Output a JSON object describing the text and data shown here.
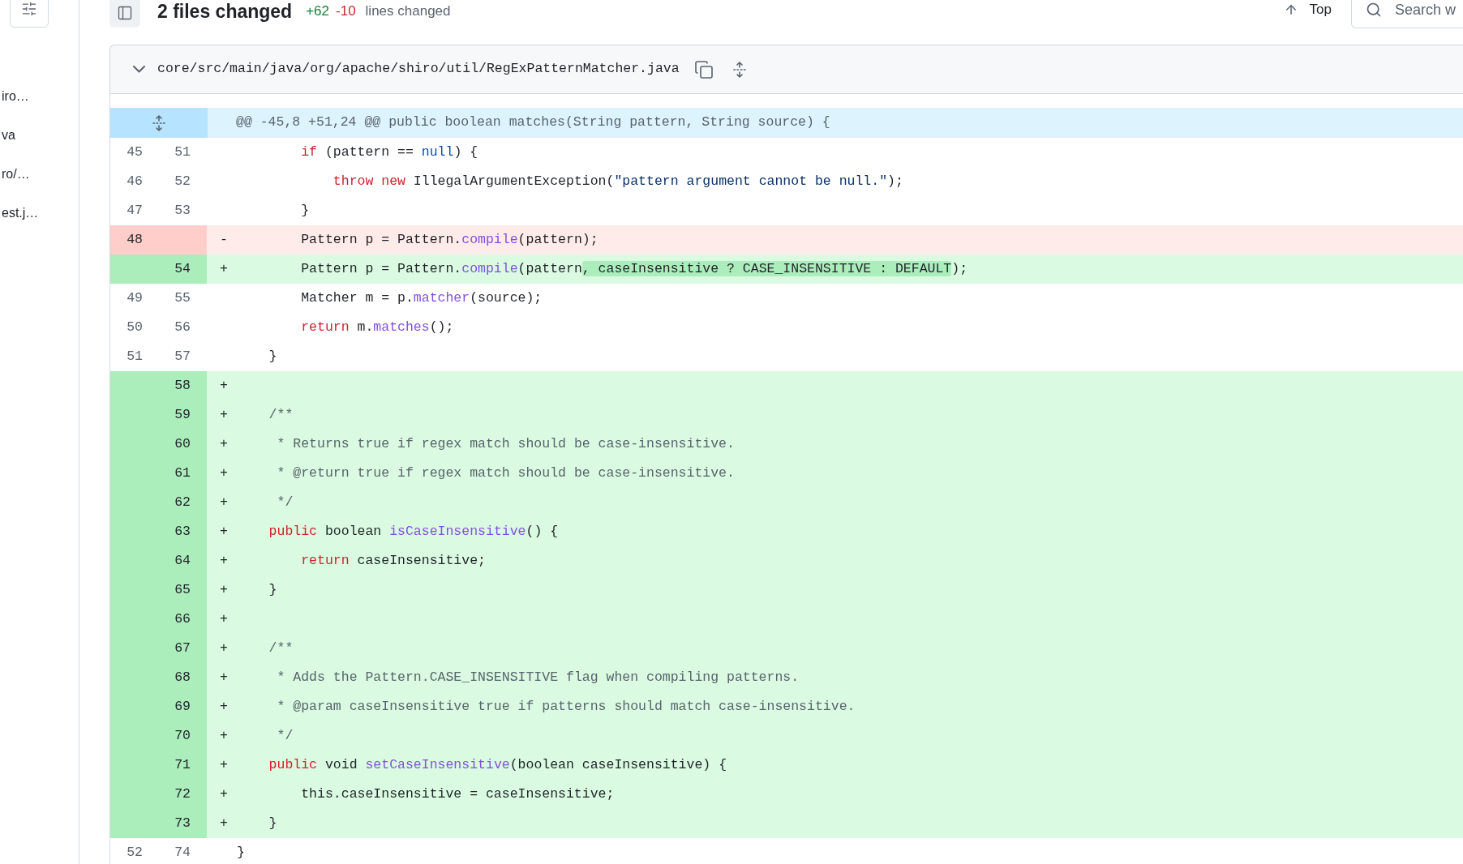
{
  "sidebar": {
    "items": [
      "iro…",
      "va",
      "ro/…",
      "est.j…"
    ]
  },
  "header": {
    "title": "2 files changed",
    "additions": "+62",
    "deletions": "-10",
    "summary": "lines changed",
    "top_link": "Top",
    "search": {
      "placeholder": "Search w"
    }
  },
  "file": {
    "path": "core/src/main/java/org/apache/shiro/util/RegExPatternMatcher.java",
    "expanded": true,
    "rows": [
      {
        "kind": "hunk",
        "text": "@@ -45,8 +51,24 @@ public boolean matches(String pattern, String source) {"
      },
      {
        "kind": "context",
        "old": "45",
        "new": "51",
        "tokens": [
          {
            "kind": "keyword",
            "text": "        if"
          },
          {
            "kind": "text",
            "text": " (pattern == "
          },
          {
            "kind": "literal",
            "text": "null"
          },
          {
            "kind": "text",
            "text": ") {"
          }
        ]
      },
      {
        "kind": "context",
        "old": "46",
        "new": "52",
        "tokens": [
          {
            "kind": "keyword",
            "text": "            throw new"
          },
          {
            "kind": "text",
            "text": " IllegalArgumentException("
          },
          {
            "kind": "string",
            "text": "\"pattern argument cannot be null.\""
          },
          {
            "kind": "text",
            "text": ");"
          }
        ]
      },
      {
        "kind": "context",
        "old": "47",
        "new": "53",
        "tokens": [
          {
            "kind": "text",
            "text": "        }"
          }
        ]
      },
      {
        "kind": "deleted",
        "old": "48",
        "sign": "-",
        "tokens": [
          {
            "kind": "text",
            "text": "        Pattern p = Pattern."
          },
          {
            "kind": "method",
            "text": "compile"
          },
          {
            "kind": "text",
            "text": "(pattern);"
          }
        ]
      },
      {
        "kind": "added",
        "new": "54",
        "sign": "+",
        "tokens": [
          {
            "kind": "text",
            "text": "        Pattern p = Pattern."
          },
          {
            "kind": "method",
            "text": "compile"
          },
          {
            "kind": "text",
            "text": "(pattern"
          },
          {
            "kind": "inserted",
            "text": ", caseInsensitive ? CASE_INSENSITIVE : DEFAULT"
          },
          {
            "kind": "text",
            "text": ");"
          }
        ]
      },
      {
        "kind": "context",
        "old": "49",
        "new": "55",
        "tokens": [
          {
            "kind": "text",
            "text": "        Matcher m = p."
          },
          {
            "kind": "method",
            "text": "matcher"
          },
          {
            "kind": "text",
            "text": "(source);"
          }
        ]
      },
      {
        "kind": "context",
        "old": "50",
        "new": "56",
        "tokens": [
          {
            "kind": "keyword",
            "text": "        return"
          },
          {
            "kind": "text",
            "text": " m."
          },
          {
            "kind": "method",
            "text": "matches"
          },
          {
            "kind": "text",
            "text": "();"
          }
        ]
      },
      {
        "kind": "context",
        "old": "51",
        "new": "57",
        "tokens": [
          {
            "kind": "text",
            "text": "    }"
          }
        ]
      },
      {
        "kind": "added",
        "new": "58",
        "sign": "+"
      },
      {
        "kind": "added",
        "new": "59",
        "sign": "+",
        "tokens": [
          {
            "kind": "comment",
            "text": "    /**"
          }
        ]
      },
      {
        "kind": "added",
        "new": "60",
        "sign": "+",
        "tokens": [
          {
            "kind": "comment",
            "text": "     * Returns true if regex match should be case-insensitive."
          }
        ]
      },
      {
        "kind": "added",
        "new": "61",
        "sign": "+",
        "tokens": [
          {
            "kind": "comment",
            "text": "     * @return true if regex match should be case-insensitive."
          }
        ]
      },
      {
        "kind": "added",
        "new": "62",
        "sign": "+",
        "tokens": [
          {
            "kind": "comment",
            "text": "     */"
          }
        ]
      },
      {
        "kind": "added",
        "new": "63",
        "sign": "+",
        "tokens": [
          {
            "kind": "keyword",
            "text": "    public"
          },
          {
            "kind": "text",
            "text": " boolean "
          },
          {
            "kind": "method",
            "text": "isCaseInsensitive"
          },
          {
            "kind": "text",
            "text": "() {"
          }
        ]
      },
      {
        "kind": "added",
        "new": "64",
        "sign": "+",
        "tokens": [
          {
            "kind": "keyword",
            "text": "        return"
          },
          {
            "kind": "text",
            "text": " caseInsensitive;"
          }
        ]
      },
      {
        "kind": "added",
        "new": "65",
        "sign": "+",
        "tokens": [
          {
            "kind": "text",
            "text": "    }"
          }
        ]
      },
      {
        "kind": "added",
        "new": "66",
        "sign": "+"
      },
      {
        "kind": "added",
        "new": "67",
        "sign": "+",
        "tokens": [
          {
            "kind": "comment",
            "text": "    /**"
          }
        ]
      },
      {
        "kind": "added",
        "new": "68",
        "sign": "+",
        "tokens": [
          {
            "kind": "comment",
            "text": "     * Adds the Pattern.CASE_INSENSITIVE flag when compiling patterns."
          }
        ]
      },
      {
        "kind": "added",
        "new": "69",
        "sign": "+",
        "tokens": [
          {
            "kind": "comment",
            "text": "     * @param caseInsensitive true if patterns should match case-insensitive."
          }
        ]
      },
      {
        "kind": "added",
        "new": "70",
        "sign": "+",
        "tokens": [
          {
            "kind": "comment",
            "text": "     */"
          }
        ]
      },
      {
        "kind": "added",
        "new": "71",
        "sign": "+",
        "tokens": [
          {
            "kind": "keyword",
            "text": "    public"
          },
          {
            "kind": "text",
            "text": " void "
          },
          {
            "kind": "method",
            "text": "setCaseInsensitive"
          },
          {
            "kind": "text",
            "text": "(boolean caseInsensitive) {"
          }
        ]
      },
      {
        "kind": "added",
        "new": "72",
        "sign": "+",
        "tokens": [
          {
            "kind": "text",
            "text": "        this.caseInsensitive = caseInsensitive;"
          }
        ]
      },
      {
        "kind": "added",
        "new": "73",
        "sign": "+",
        "tokens": [
          {
            "kind": "text",
            "text": "    }"
          }
        ]
      },
      {
        "kind": "context",
        "old": "52",
        "new": "74",
        "tokens": [
          {
            "kind": "text",
            "text": "}"
          }
        ]
      }
    ]
  }
}
